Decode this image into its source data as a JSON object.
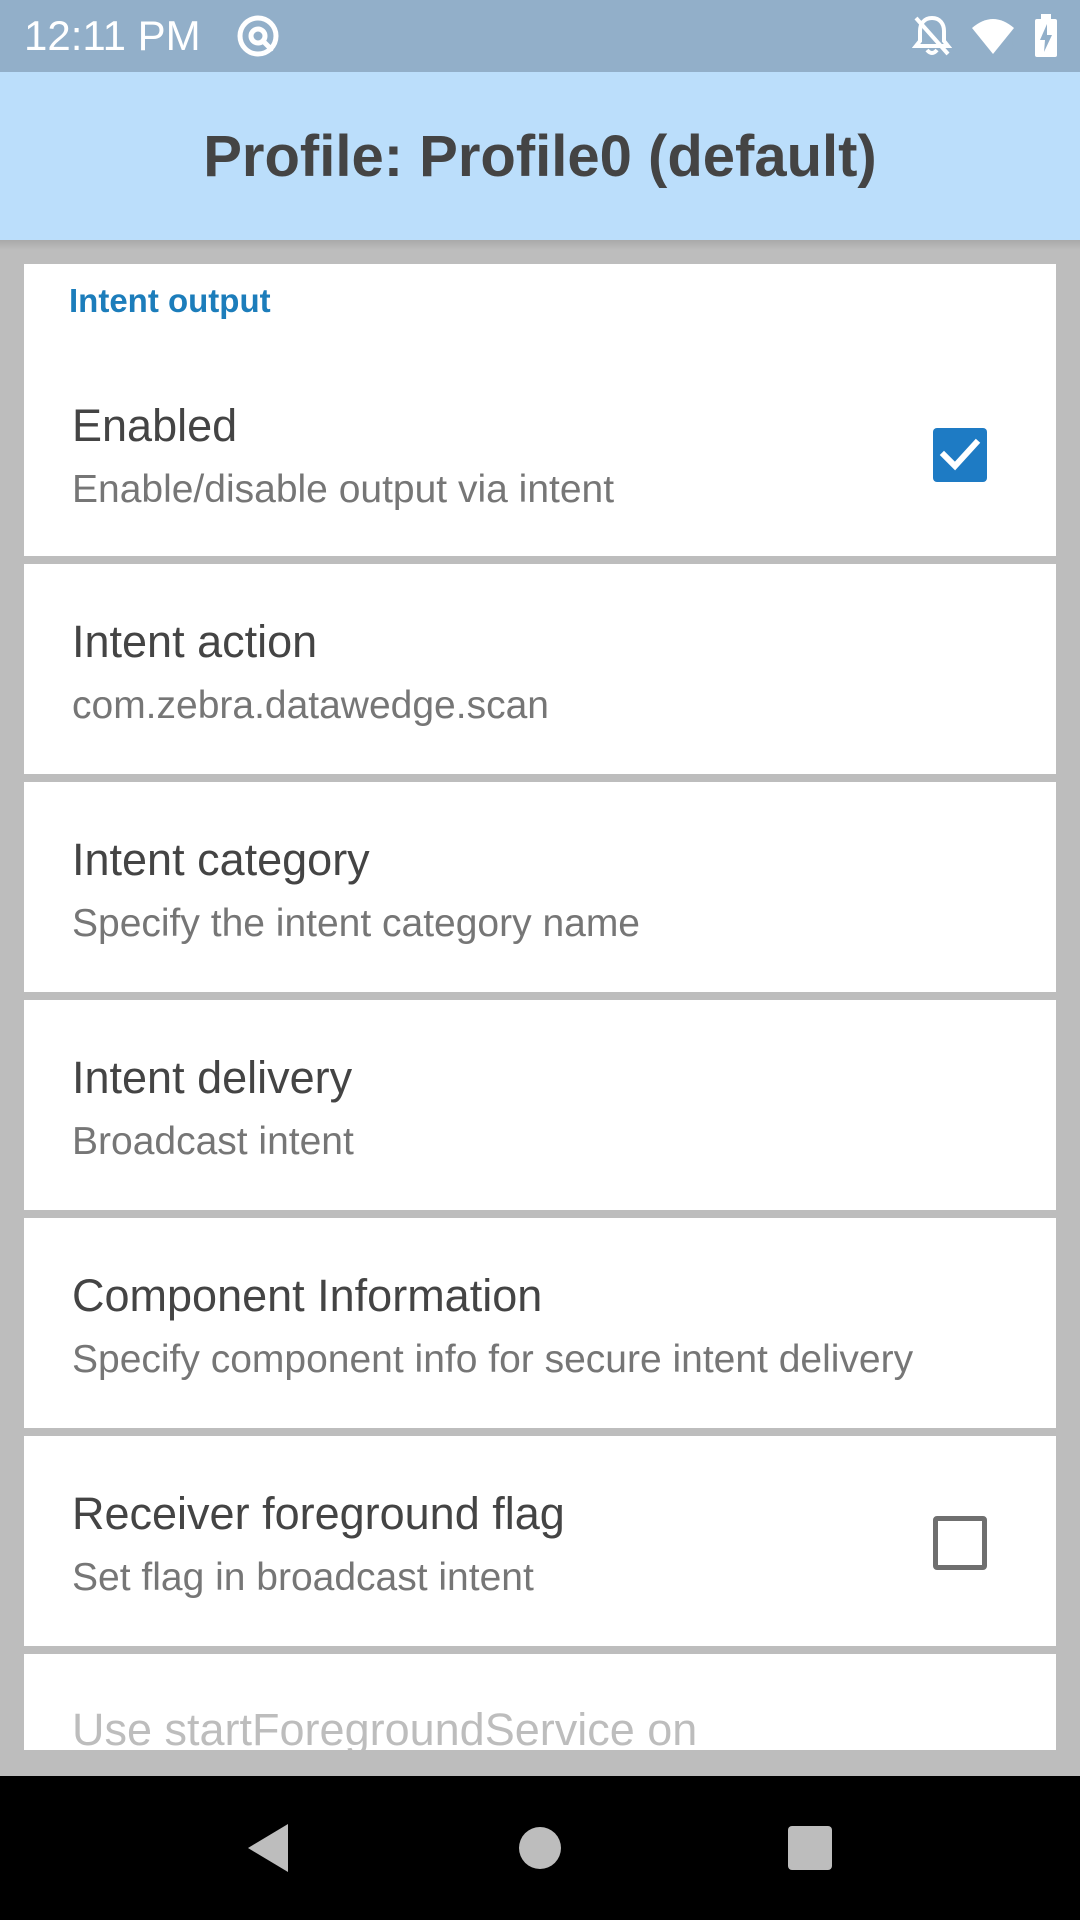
{
  "status_bar": {
    "time": "12:11 PM",
    "icons": [
      "at-sign-icon",
      "notifications-off-icon",
      "wifi-icon",
      "battery-charging-icon"
    ],
    "wifi_badge": "4"
  },
  "app_bar": {
    "title": "Profile: Profile0 (default)"
  },
  "section": {
    "title": "Intent output"
  },
  "preferences": [
    {
      "title": "Enabled",
      "summary": "Enable/disable output via intent",
      "checkbox": true
    },
    {
      "title": "Intent action",
      "summary": "com.zebra.datawedge.scan"
    },
    {
      "title": "Intent category",
      "summary": "Specify the intent category name"
    },
    {
      "title": "Intent delivery",
      "summary": "Broadcast intent"
    },
    {
      "title": "Component Information",
      "summary": "Specify component info for secure intent delivery"
    },
    {
      "title": "Receiver foreground flag",
      "summary": "Set flag in broadcast intent",
      "checkbox": false
    },
    {
      "title": "Use startForegroundService on"
    }
  ],
  "colors": {
    "status_bar": "#92afc9",
    "app_bar": "#bbdefb",
    "accent": "#1e7bc4",
    "section_title": "#1c7dbb",
    "background": "#bdbdbd"
  },
  "nav_bar": {
    "buttons": [
      "back-icon",
      "home-icon",
      "recents-icon"
    ]
  }
}
